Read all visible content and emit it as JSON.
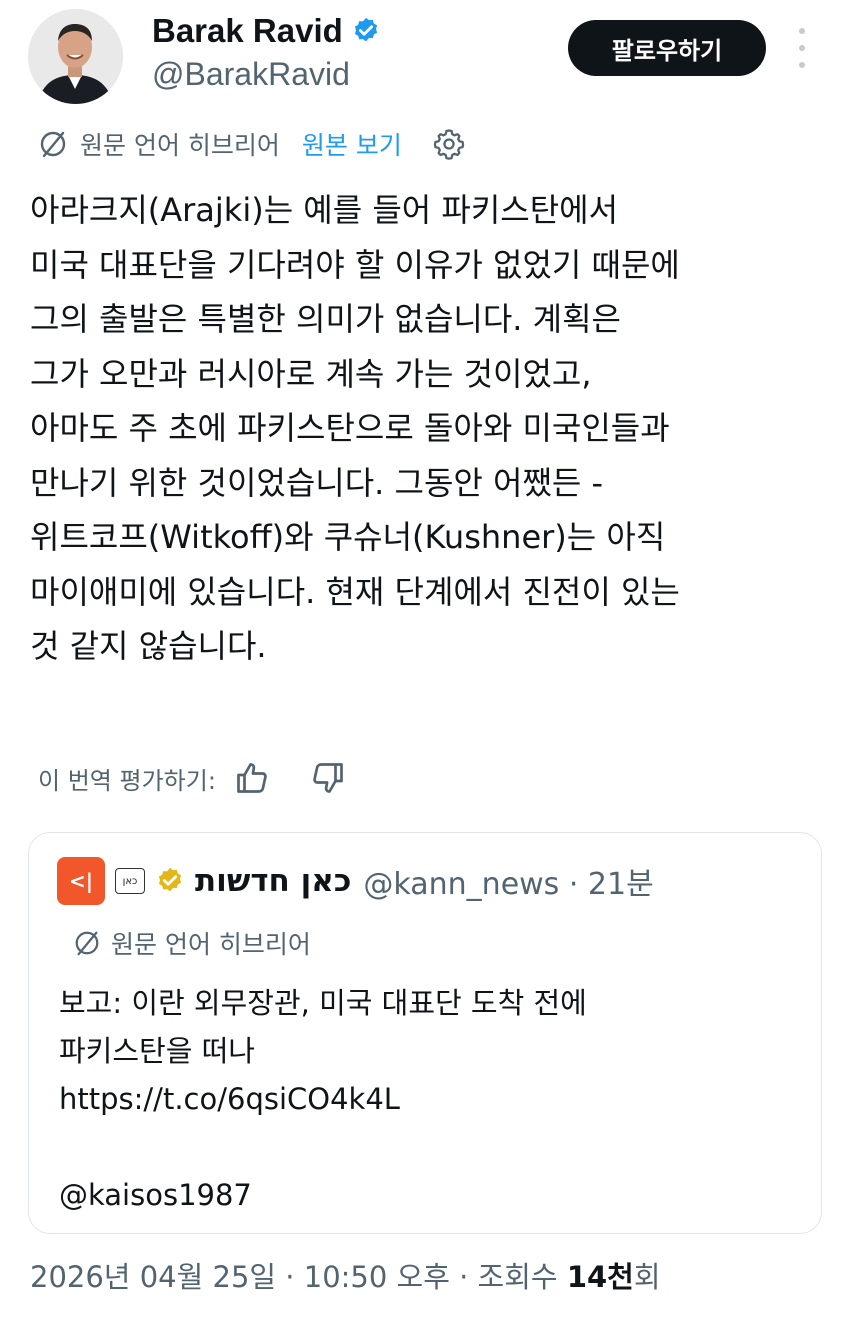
{
  "author": {
    "display_name": "Barak Ravid",
    "handle": "@BarakRavid",
    "avatar_icon": "avatar-photo"
  },
  "follow_label": "팔로우하기",
  "translation": {
    "source_label": "원문 언어 히브리어",
    "view_original": "원본 보기"
  },
  "tweet": {
    "lines": [
      "아라크지(Arajki)는 예를 들어 파키스탄에서",
      "미국 대표단을 기다려야 할 이유가 없었기 때문에",
      "그의 출발은 특별한 의미가 없습니다. 계획은",
      "그가 오만과 러시아로 계속 가는 것이었고,",
      "아마도 주 초에 파키스탄으로 돌아와 미국인들과",
      "만나기 위한 것이었습니다. 그동안 어쨌든 -",
      "위트코프(Witkoff)와 쿠슈너(Kushner)는 아직",
      "마이애미에 있습니다. 현재 단계에서 진전이 있는",
      "것 같지 않습니다."
    ]
  },
  "rate": {
    "label": "이 번역 평가하기:"
  },
  "quote": {
    "logo_text": "<|",
    "badge_text": "כאן",
    "name": "כאן חדשות",
    "handle_time": "@kann_news · 21분",
    "lang_label": "원문 언어 히브리어",
    "lines": [
      "보고: 이란 외무장관, 미국 대표단 도착 전에",
      "파키스탄을 떠나",
      "https://t.co/6qsiCO4k4L",
      "",
      "@kaisos1987"
    ]
  },
  "meta": {
    "timestamp": "2026년 04월 25일 · 10:50 오후 · 조회수 ",
    "views": "14천",
    "views_suffix": "회"
  },
  "colors": {
    "accent": "#1d9bf0",
    "secondary_text": "#536471",
    "primary_text": "#0f1419",
    "kan_orange": "#f2562b"
  }
}
